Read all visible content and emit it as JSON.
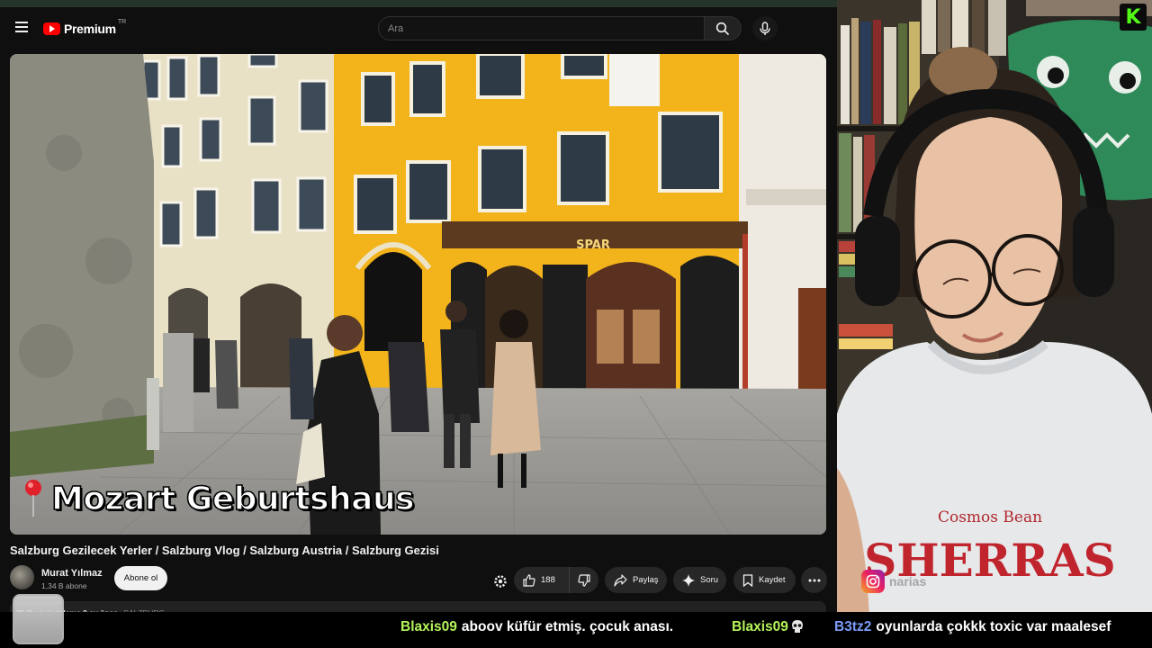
{
  "youtube": {
    "logo": {
      "brand": "Premium",
      "region": "TR"
    },
    "search": {
      "placeholder": "Ara"
    },
    "video": {
      "overlay_caption": "Mozart Geburtshaus",
      "store_sign": "SPAR",
      "title": "Salzburg Gezilecek Yerler / Salzburg Vlog / Salzburg Austria / Salzburg Gezisi"
    },
    "channel": {
      "name": "Murat Yılmaz",
      "subscribers": "1,34 B abone",
      "subscribe_label": "Abone ol"
    },
    "actions": {
      "like_count": "188",
      "share_label": "Paylaş",
      "ask_label": "Soru",
      "save_label": "Kaydet"
    },
    "description": {
      "views": "25 B görüntüleme",
      "date": "9 ay önce",
      "tag": "SALZBURG"
    }
  },
  "webcam": {
    "shirt_text_top": "Cosmos Bean",
    "shirt_text_main": "SHERRAS",
    "instagram_handle": "narias"
  },
  "ticker": [
    {
      "user": "Blaxis09",
      "message": "aboov küfür etmiş. çocuk anası."
    },
    {
      "user": "Blaxis09",
      "message": ""
    },
    {
      "user": "B3tz2",
      "message": "oyunlarda çokkk toxic var maalesef"
    }
  ],
  "colors": {
    "youtube_red": "#ff0000",
    "kick_green": "#53fc18",
    "chat_user_green": "#b3f35a",
    "chat_user_blue": "#7b9cf7"
  }
}
